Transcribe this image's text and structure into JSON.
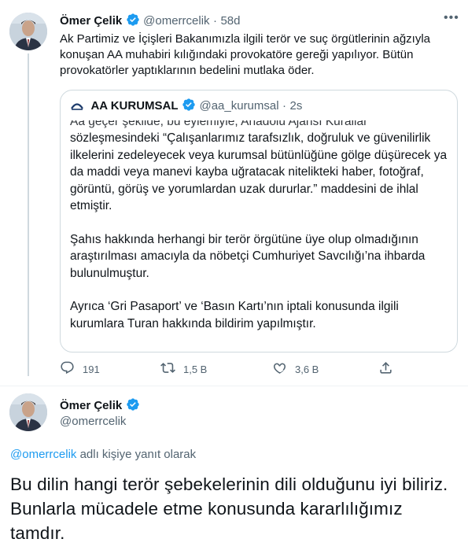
{
  "tweet1": {
    "author_name": "Ömer Çelik",
    "author_handle": "@omerrcelik",
    "separator": "·",
    "time": "58d",
    "text": "Ak Partimiz ve İçişleri Bakanımızla ilgili terör ve suç örgütlerinin ağzıyla konuşan AA muhabiri kılığındaki provokatöre gereği yapılıyor. Bütün provokatörler yaptıklarının bedelini mutlaka öder.",
    "quote": {
      "author_name": "AA KURUMSAL",
      "author_handle": "@aa_kurumsal",
      "separator": "·",
      "time": "2s",
      "cut_line": "Aa geçer şekilde, bu eylemiyle, Anadolu Ajansı Kurallar",
      "paragraph1": "sözleşmesindeki “Çalışanlarımız tarafsızlık, doğruluk ve güvenilirlik ilkelerini zedeleyecek veya kurumsal bütünlüğüne gölge düşürecek ya da maddi veya manevi kayba uğratacak nitelikteki haber, fotoğraf, görüntü, görüş ve yorumlardan uzak dururlar.” maddesini de ihlal etmiştir.",
      "paragraph2": "Şahıs hakkında herhangi bir terör örgütüne üye olup olmadığının araştırılması amacıyla da nöbetçi Cumhuriyet Savcılığı’na ihbarda bulunulmuştur.",
      "paragraph3": "Ayrıca ‘Gri Pasaport’ ve ‘Basın Kartı’nın iptali konusunda ilgili kurumlara Turan hakkında bildirim yapılmıştır."
    },
    "actions": {
      "replies": "191",
      "retweets": "1,5 B",
      "likes": "3,6 B"
    }
  },
  "tweet2": {
    "author_name": "Ömer Çelik",
    "author_handle": "@omerrcelik",
    "reply_to_handle": "@omerrcelik",
    "reply_to_suffix": " adlı kişiye yanıt olarak",
    "text": "Bu dilin hangi terör şebekelerinin dili olduğunu iyi biliriz. Bunlarla mücadele etme konusunda kararlılığımız tamdır."
  },
  "icons": {
    "more": "more-horizontal-icon",
    "verified": "verified-badge-icon",
    "reply": "reply-icon",
    "retweet": "retweet-icon",
    "like": "heart-icon",
    "share": "share-icon"
  },
  "colors": {
    "accent": "#1d9bf0",
    "text": "#0f1419",
    "muted": "#536471",
    "border": "#cfd9de"
  }
}
